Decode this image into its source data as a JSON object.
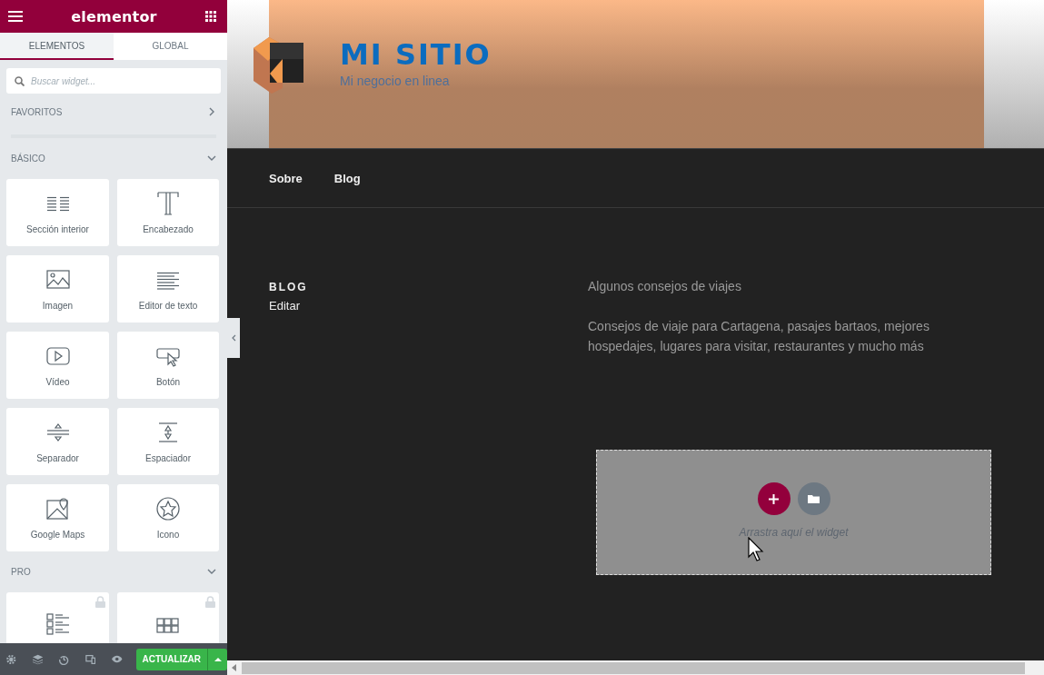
{
  "editor": {
    "logo": "elementor",
    "tabs": [
      {
        "label": "ELEMENTOS",
        "selected": true
      },
      {
        "label": "GLOBAL",
        "selected": false
      }
    ],
    "search": {
      "placeholder": "Buscar widget..."
    },
    "categories": [
      {
        "title": "FAVORITOS",
        "expanded": false
      },
      {
        "title": "BÁSICO",
        "expanded": true,
        "widgets": [
          {
            "kind": "inner-section",
            "label": "Sección interior",
            "locked": false
          },
          {
            "kind": "heading",
            "label": "Encabezado",
            "locked": false
          },
          {
            "kind": "image",
            "label": "Imagen",
            "locked": false
          },
          {
            "kind": "text-editor",
            "label": "Editor de texto",
            "locked": false
          },
          {
            "kind": "video",
            "label": "Vídeo",
            "locked": false
          },
          {
            "kind": "button",
            "label": "Botón",
            "locked": false
          },
          {
            "kind": "divider",
            "label": "Separador",
            "locked": false
          },
          {
            "kind": "spacer",
            "label": "Espaciador",
            "locked": false
          },
          {
            "kind": "map",
            "label": "Google Maps",
            "locked": false
          },
          {
            "kind": "icon",
            "label": "Icono",
            "locked": false
          }
        ]
      },
      {
        "title": "PRO",
        "expanded": true,
        "widgets": [
          {
            "kind": "posts",
            "locked": true
          },
          {
            "kind": "portfolio",
            "locked": true
          }
        ]
      }
    ],
    "update_button": "ACTUALIZAR"
  },
  "site": {
    "title": "MI SITIO",
    "tagline": "Mi negocio en linea",
    "menu": [
      "Sobre",
      "Blog"
    ],
    "page_title": "BLOG",
    "edit_link": "Editar",
    "paragraphs": [
      "Algunos consejos de viajes",
      "Consejos de viaje para Cartagena, pasajes bartaos, mejores hospedajes, lugares para visitar, restaurantes y mucho más"
    ],
    "drop_zone": {
      "hint": "Arrastra aquí el widget"
    }
  }
}
